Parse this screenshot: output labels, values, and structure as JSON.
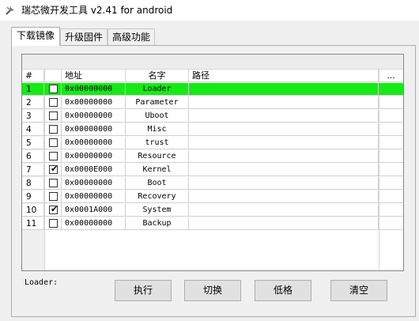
{
  "window": {
    "title": "瑞芯微开发工具 v2.41 for android",
    "icon": "tool-icon"
  },
  "tabs": [
    {
      "label": "下载镜像",
      "active": true
    },
    {
      "label": "升级固件",
      "active": false
    },
    {
      "label": "高级功能",
      "active": false
    }
  ],
  "table": {
    "headers": {
      "index": "#",
      "check": "",
      "address": "地址",
      "name": "名字",
      "path": "路径",
      "more": "..."
    },
    "rows": [
      {
        "index": "1",
        "checked": false,
        "address": "0x00000000",
        "name": "Loader",
        "path": "",
        "selected": true
      },
      {
        "index": "2",
        "checked": false,
        "address": "0x00000000",
        "name": "Parameter",
        "path": ""
      },
      {
        "index": "3",
        "checked": false,
        "address": "0x00000000",
        "name": "Uboot",
        "path": ""
      },
      {
        "index": "4",
        "checked": false,
        "address": "0x00000000",
        "name": "Misc",
        "path": ""
      },
      {
        "index": "5",
        "checked": false,
        "address": "0x00000000",
        "name": "trust",
        "path": ""
      },
      {
        "index": "6",
        "checked": false,
        "address": "0x00000000",
        "name": "Resource",
        "path": ""
      },
      {
        "index": "7",
        "checked": true,
        "address": "0x0000E000",
        "name": "Kernel",
        "path": ""
      },
      {
        "index": "8",
        "checked": false,
        "address": "0x00000000",
        "name": "Boot",
        "path": ""
      },
      {
        "index": "9",
        "checked": false,
        "address": "0x00000000",
        "name": "Recovery",
        "path": ""
      },
      {
        "index": "10",
        "checked": true,
        "address": "0x0001A000",
        "name": "System",
        "path": ""
      },
      {
        "index": "11",
        "checked": false,
        "address": "0x00000000",
        "name": "Backup",
        "path": ""
      }
    ]
  },
  "status": {
    "loader_label": "Loader:"
  },
  "buttons": {
    "run": "执行",
    "switch": "切换",
    "format": "低格",
    "clear": "清空"
  },
  "colors": {
    "selected_row": "#16ea16"
  }
}
